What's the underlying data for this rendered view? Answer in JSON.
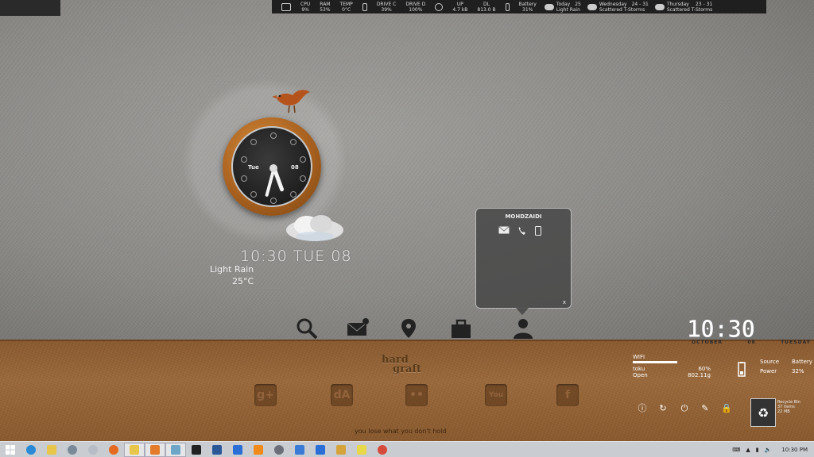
{
  "topbar": {
    "cpu_label": "CPU",
    "cpu": "9%",
    "ram_label": "RAM",
    "ram": "53%",
    "temp_label": "TEMP",
    "temp": "0°C",
    "drivec_label": "DRIVE C",
    "drivec": "39%",
    "drived_label": "DRIVE D",
    "drived": "100%",
    "up_label": "UP",
    "up": "4.7 kB",
    "dl_label": "DL",
    "dl": "813.0 B",
    "battery_label": "Battery",
    "battery": "31%",
    "forecast": [
      {
        "day": "Today",
        "temp": "25",
        "cond": "Light Rain"
      },
      {
        "day": "Wednesday",
        "temp": "24 - 31",
        "cond": "Scattered T-Storms"
      },
      {
        "day": "Thursday",
        "temp": "23 - 31",
        "cond": "Scattered T-Storms"
      }
    ]
  },
  "clock": {
    "day": "Tue",
    "date": "08"
  },
  "weather": {
    "time_line": "10:30 TUE 08",
    "condition": "Light Rain",
    "temperature": "25°C",
    "cloud_caption": "Light Rain"
  },
  "contact": {
    "name": "MOHDZAIDI",
    "close": "x"
  },
  "dock": [
    "search-icon",
    "mail-icon",
    "location-pin-icon",
    "briefcase-icon",
    "user-icon"
  ],
  "logo": {
    "line1": "hard",
    "line2": "graft"
  },
  "social": [
    {
      "name": "google-plus-icon",
      "glyph": "g+"
    },
    {
      "name": "deviantart-icon",
      "glyph": "dA"
    },
    {
      "name": "flickr-icon",
      "glyph": "••"
    },
    {
      "name": "youtube-icon",
      "glyph": "You"
    },
    {
      "name": "facebook-icon",
      "glyph": "f"
    }
  ],
  "quote": "you lose what you don't hold",
  "big_clock": {
    "time": "10:30",
    "month": "OCTOBER",
    "date": "08",
    "weekday": "TUESDAY"
  },
  "wifi": {
    "label": "WIFI",
    "network": "toku",
    "status": "Open",
    "strength": "60%",
    "speed": "802.11g",
    "level": 0.6
  },
  "battery": {
    "source_label": "Source",
    "source_value": "Battery",
    "power_label": "Power",
    "power_value": "32%"
  },
  "recycle": {
    "title": "Recycle Bin",
    "items": "37 items",
    "size": "22 MB"
  },
  "taskbar": {
    "apps": [
      "start",
      "ie",
      "explorer",
      "app1",
      "app2",
      "firefox",
      "folder",
      "video",
      "steam",
      "app3",
      "word",
      "dropbox",
      "vlc",
      "app4",
      "chrome2",
      "app5",
      "tools",
      "sticky",
      "chrome"
    ],
    "time": "10:30 PM"
  },
  "colors": {
    "leather": "#9b6a3c",
    "felt": "#8e8d8b",
    "taskbar": "#c9ccd1"
  }
}
